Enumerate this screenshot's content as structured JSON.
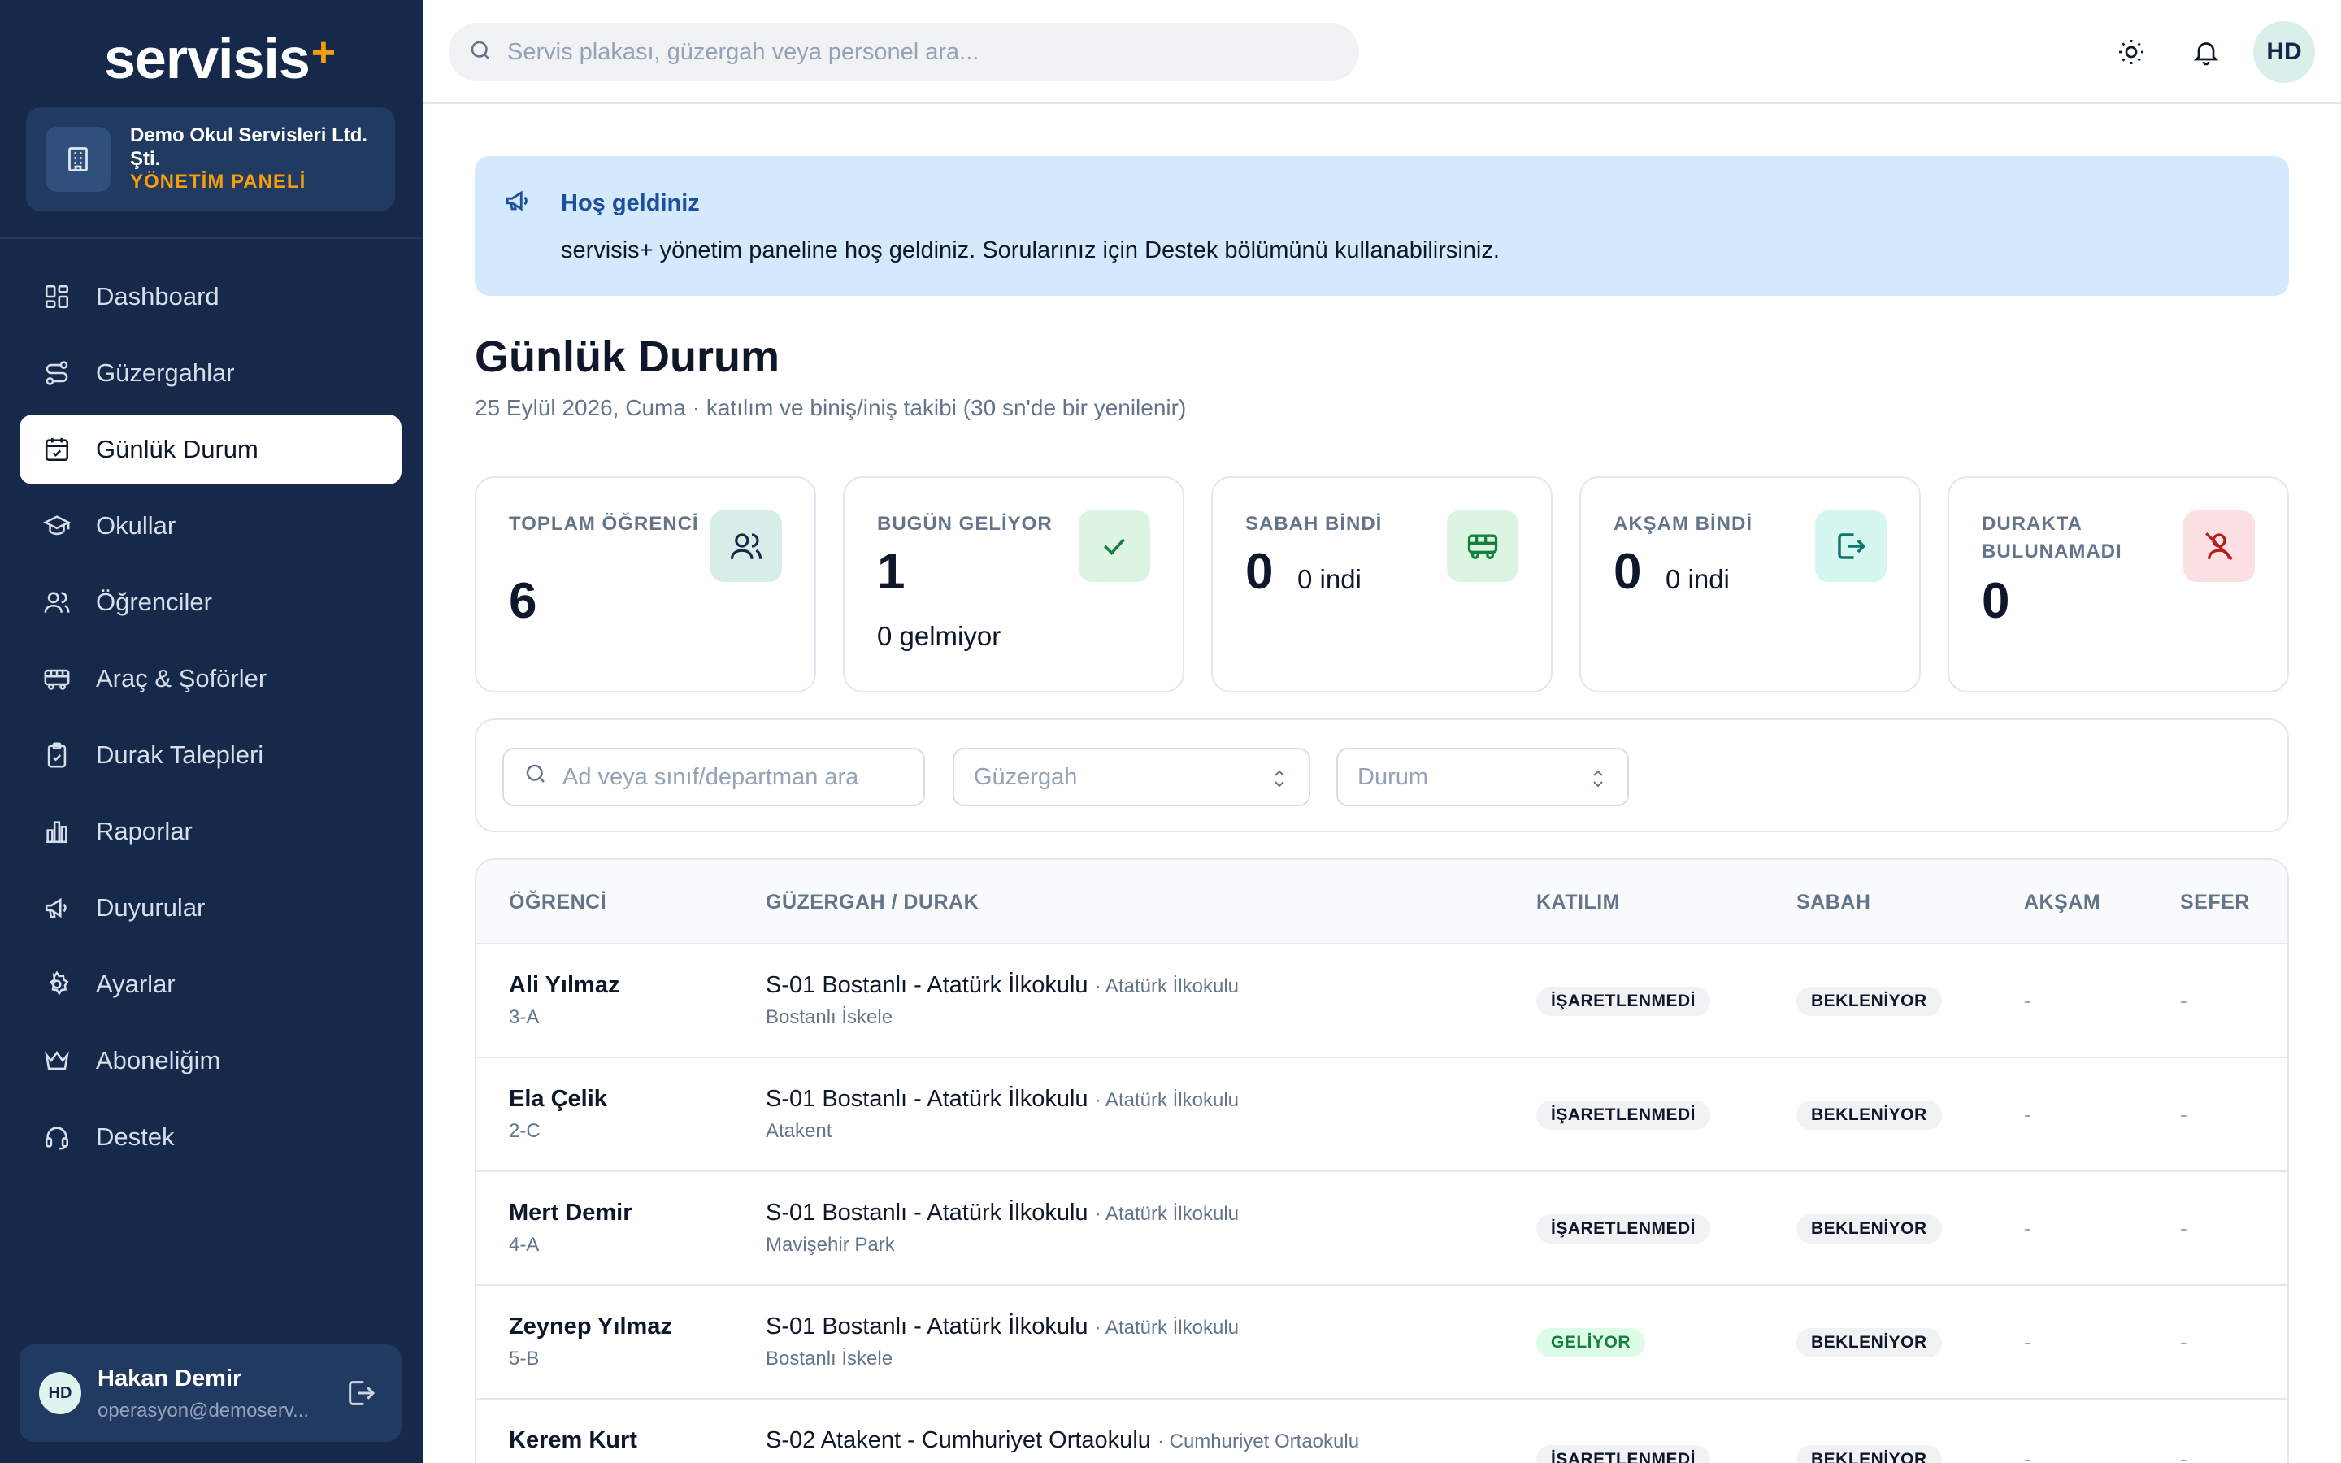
{
  "sidebar": {
    "logo_text": "servisis",
    "logo_plus": "+",
    "org_name": "Demo Okul Servisleri Ltd. Şti.",
    "org_role": "YÖNETİM PANELİ",
    "nav": [
      {
        "label": "Dashboard",
        "icon": "dashboard-icon",
        "active": false
      },
      {
        "label": "Güzergahlar",
        "icon": "route-icon",
        "active": false
      },
      {
        "label": "Günlük Durum",
        "icon": "calendar-check-icon",
        "active": true
      },
      {
        "label": "Okullar",
        "icon": "graduation-cap-icon",
        "active": false
      },
      {
        "label": "Öğrenciler",
        "icon": "users-icon",
        "active": false
      },
      {
        "label": "Araç & Şoförler",
        "icon": "bus-icon",
        "active": false
      },
      {
        "label": "Durak Talepleri",
        "icon": "clipboard-icon",
        "active": false
      },
      {
        "label": "Raporlar",
        "icon": "bar-chart-icon",
        "active": false
      },
      {
        "label": "Duyurular",
        "icon": "megaphone-icon",
        "active": false
      },
      {
        "label": "Ayarlar",
        "icon": "settings-icon",
        "active": false
      },
      {
        "label": "Aboneliğim",
        "icon": "crown-icon",
        "active": false
      },
      {
        "label": "Destek",
        "icon": "headset-icon",
        "active": false
      }
    ],
    "user": {
      "initials": "HD",
      "name": "Hakan Demir",
      "email": "operasyon@demoserv..."
    }
  },
  "topbar": {
    "search_placeholder": "Servis plakası, güzergah veya personel ara...",
    "avatar_initials": "HD"
  },
  "banner": {
    "title": "Hoş geldiniz",
    "text": "servisis+ yönetim paneline hoş geldiniz. Sorularınız için Destek bölümünü kullanabilirsiniz."
  },
  "page": {
    "title": "Günlük Durum",
    "subtitle": "25 Eylül 2026, Cuma · katılım ve biniş/iniş takibi (30 sn'de bir yenilenir)"
  },
  "stats": [
    {
      "label": "TOPLAM ÖĞRENCİ",
      "value": "6",
      "icon": "users-icon",
      "color": "#d7ede8"
    },
    {
      "label": "BUGÜN GELİYOR",
      "value": "1",
      "sub": "0 gelmiyor",
      "icon": "check-icon",
      "color": "#dcf5e3"
    },
    {
      "label": "SABAH BİNDİ",
      "value": "0",
      "aside": "0 indi",
      "icon": "bus-icon",
      "color": "#dcf5e3"
    },
    {
      "label": "AKŞAM BİNDİ",
      "value": "0",
      "aside": "0 indi",
      "icon": "logout-icon",
      "color": "#d5f7ef"
    },
    {
      "label": "DURAKTA BULUNAMADI",
      "value": "0",
      "icon": "user-x-icon",
      "color": "#fde0e3"
    }
  ],
  "filters": {
    "search_placeholder": "Ad veya sınıf/departman ara",
    "route_placeholder": "Güzergah",
    "status_placeholder": "Durum"
  },
  "table": {
    "columns": [
      "ÖĞRENCİ",
      "GÜZERGAH / DURAK",
      "KATILIM",
      "SABAH",
      "AKŞAM",
      "SEFER"
    ],
    "rows": [
      {
        "name": "Ali Yılmaz",
        "class": "3-A",
        "route": "S-01 Bostanlı - Atatürk İlkokulu",
        "school": "· Atatürk İlkokulu",
        "stop": "Bostanlı İskele",
        "attendance": "İŞARETLENMEDİ",
        "morning": "BEKLENİYOR",
        "evening": "-",
        "trip": "-"
      },
      {
        "name": "Ela Çelik",
        "class": "2-C",
        "route": "S-01 Bostanlı - Atatürk İlkokulu",
        "school": "· Atatürk İlkokulu",
        "stop": "Atakent",
        "attendance": "İŞARETLENMEDİ",
        "morning": "BEKLENİYOR",
        "evening": "-",
        "trip": "-"
      },
      {
        "name": "Mert Demir",
        "class": "4-A",
        "route": "S-01 Bostanlı - Atatürk İlkokulu",
        "school": "· Atatürk İlkokulu",
        "stop": "Mavişehir Park",
        "attendance": "İŞARETLENMEDİ",
        "morning": "BEKLENİYOR",
        "evening": "-",
        "trip": "-"
      },
      {
        "name": "Zeynep Yılmaz",
        "class": "5-B",
        "route": "S-01 Bostanlı - Atatürk İlkokulu",
        "school": "· Atatürk İlkokulu",
        "stop": "Bostanlı İskele",
        "attendance": "GELİYOR",
        "morning": "BEKLENİYOR",
        "evening": "-",
        "trip": "-"
      },
      {
        "name": "Kerem Kurt",
        "class": "",
        "route": "S-02 Atakent - Cumhuriyet Ortaokulu",
        "school": "· Cumhuriyet Ortaokulu",
        "stop": "",
        "attendance": "İŞARETLENMEDİ",
        "morning": "BEKLENİYOR",
        "evening": "-",
        "trip": "-"
      }
    ]
  },
  "colors": {
    "sidebar_bg": "#17294a",
    "accent": "#f59e0b",
    "banner_bg": "#d4eafc",
    "green": "#15803d"
  }
}
